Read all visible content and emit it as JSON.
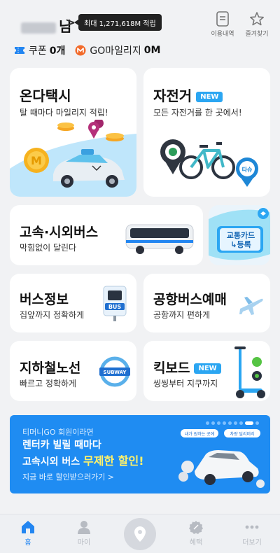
{
  "header": {
    "user_suffix": "님",
    "tooltip": "최대 1,271,618M 적립",
    "usage_label": "이용내역",
    "favorites_label": "즐겨찾기"
  },
  "points": {
    "coupon_label": "쿠폰",
    "coupon_value": "0개",
    "mileage_label": "GO마일리지",
    "mileage_value": "0M"
  },
  "cards": {
    "taxi": {
      "title": "온다택시",
      "sub": "탈 때마다 마일리지 적립!",
      "coin_letter": "M"
    },
    "bike": {
      "title": "자전거",
      "badge": "NEW",
      "sub": "모든 자전거를 한 곳에서!",
      "pin_text": "타슈"
    },
    "bus": {
      "title": "고속·시외버스",
      "sub": "막힘없이 달린다"
    },
    "transit_card": {
      "line1": "교통카드",
      "line2": "↳등록"
    },
    "bus_info": {
      "title": "버스정보",
      "sub": "집앞까지 정확하게",
      "icon_text": "BUS"
    },
    "airport": {
      "title": "공항버스예매",
      "sub": "공항까지 편하게"
    },
    "subway": {
      "title": "지하철노선",
      "sub": "빠르고 정확하게",
      "icon_text": "SUBWAY"
    },
    "kickboard": {
      "title": "킥보드",
      "badge": "NEW",
      "sub": "씽씽부터 지쿠까지"
    }
  },
  "banner": {
    "kicker": "티머니GO 회원이라면",
    "line1": "렌터카 빌릴 때마다",
    "line2_prefix": "고속시외 버스 ",
    "line2_highlight": "무제한 할인!",
    "link": "지금 바로 할인받으러가기 >",
    "tag1": "내가 원하는 곳에",
    "tag2": "차량 딜리버리",
    "page_count": 9,
    "active_page": 7
  },
  "bottomnav": {
    "home": "홈",
    "my": "마이",
    "benefits": "혜택",
    "more": "더보기"
  },
  "colors": {
    "accent": "#2386f1",
    "badge": "#2ba6f2",
    "banner": "#1f8cf2",
    "highlight": "#fff26b"
  }
}
